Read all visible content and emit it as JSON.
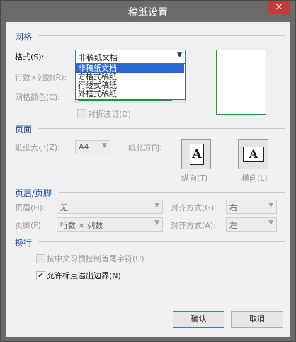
{
  "window": {
    "title": "稿纸设置",
    "close_glyph": "✕"
  },
  "grid": {
    "section": "网格",
    "format_label": "格式(S):",
    "format_value": "非稿纸文档",
    "format_options": [
      "非稿纸文档",
      "方格式稿纸",
      "行线式稿纸",
      "外框式稿纸"
    ],
    "rows_cols_label": "行数×列数(R):",
    "grid_color_label": "网格颜色(C):",
    "fold_label": "对折装订(D)",
    "grid_color": "#1f9a2e",
    "preview_border_color": "#1f9a2e"
  },
  "page": {
    "section": "页面",
    "paper_size_label": "纸张大小(Z):",
    "paper_size_value": "A4",
    "orientation_label": "纸张方向:",
    "portrait_label": "纵向(T)",
    "landscape_label": "横向(L)",
    "orientation_glyph": "A"
  },
  "header_footer": {
    "section": "页眉/页脚",
    "header_label": "页眉(H):",
    "header_value": "无",
    "header_align_label": "对齐方式(G):",
    "header_align_value": "右",
    "footer_label": "页脚(F):",
    "footer_value": "行数 × 列数",
    "footer_align_label": "对齐方式(A):",
    "footer_align_value": "左"
  },
  "wrap": {
    "section": "换行",
    "opt1_label": "按中文习惯控制首尾字符(U)",
    "opt1_checked": false,
    "opt2_label": "允许标点溢出边界(N)",
    "opt2_checked": true,
    "check_glyph": "✔"
  },
  "buttons": {
    "ok": "确认",
    "cancel": "取消"
  },
  "icons": {
    "dropdown": "dropdown-arrow-icon",
    "close": "close-icon",
    "check": "checkmark-icon"
  },
  "colors": {
    "accent_blue": "#1f4ea8",
    "selection": "#2b67d1",
    "close_red": "#c43c35"
  }
}
